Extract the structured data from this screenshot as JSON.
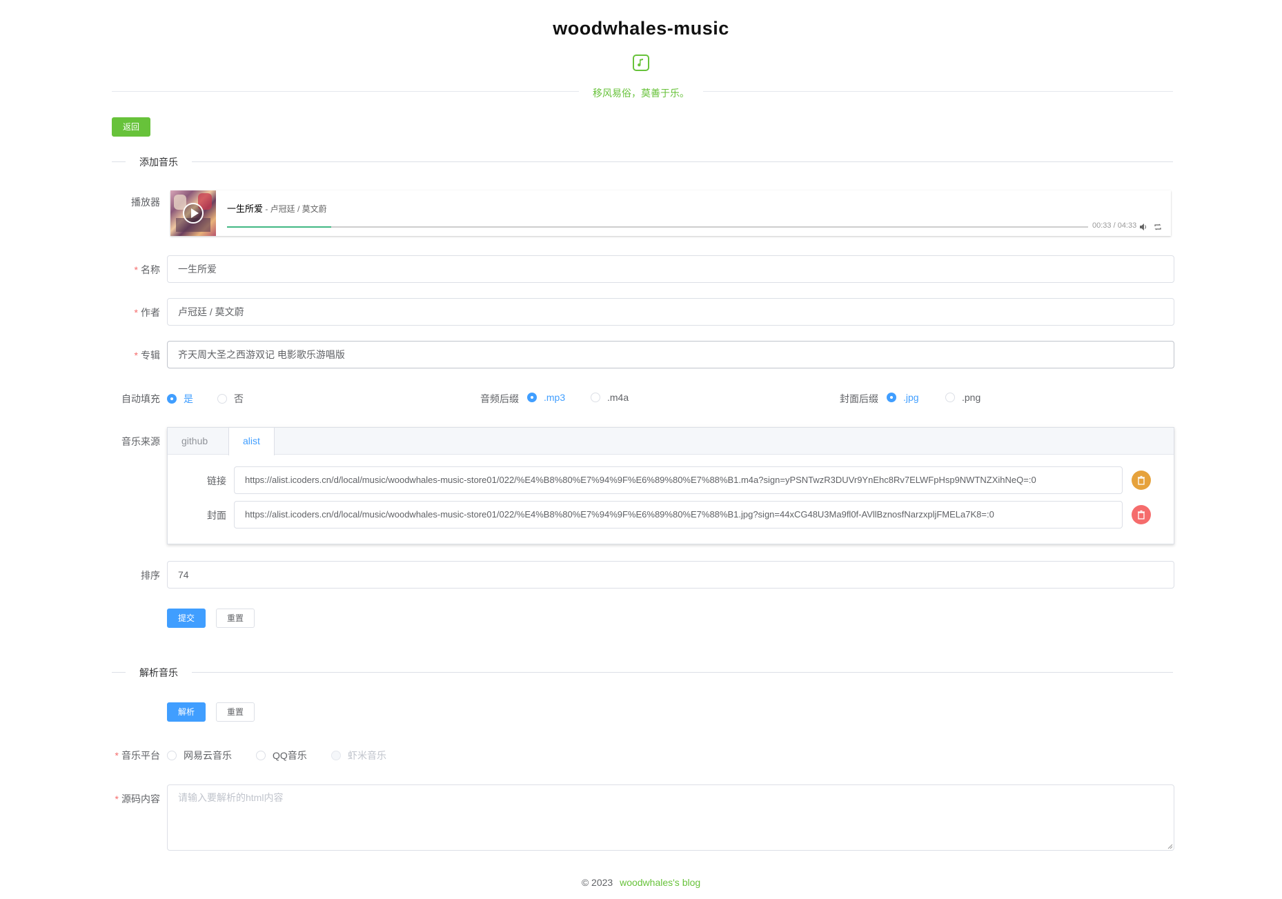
{
  "header": {
    "title": "woodwhales-music",
    "logo_icon": "music-note-icon",
    "slogan": "移风易俗，莫善于乐。"
  },
  "back_button": "返回",
  "add_section": {
    "title": "添加音乐",
    "player_label": "播放器",
    "player": {
      "song_title": "一生所爱",
      "song_author": " - 卢冠廷 / 莫文蔚",
      "time": "00:33 / 04:33",
      "progress": 0.121
    },
    "name_label": "名称",
    "name_value": "一生所爱",
    "author_label": "作者",
    "author_value": "卢冠廷 / 莫文蔚",
    "album_label": "专辑",
    "album_value": "齐天周大圣之西游双记 电影歌乐游唱版",
    "autofill": {
      "label": "自动填充",
      "options": [
        "是",
        "否"
      ],
      "selected": "是"
    },
    "audio_suffix": {
      "label": "音频后缀",
      "options": [
        ".mp3",
        ".m4a"
      ],
      "selected": ".mp3"
    },
    "cover_suffix": {
      "label": "封面后缀",
      "options": [
        ".jpg",
        ".png"
      ],
      "selected": ".jpg"
    },
    "source_label": "音乐来源",
    "source_tabs": [
      "github",
      "alist"
    ],
    "active_tab": "alist",
    "link_label": "链接",
    "link_value": "https://alist.icoders.cn/d/local/music/woodwhales-music-store01/022/%E4%B8%80%E7%94%9F%E6%89%80%E7%88%B1.m4a?sign=yPSNTwzR3DUVr9YnEhc8Rv7ELWFpHsp9NWTNZXihNeQ=:0",
    "cover_label": "封面",
    "cover_value": "https://alist.icoders.cn/d/local/music/woodwhales-music-store01/022/%E4%B8%80%E7%94%9F%E6%89%80%E7%88%B1.jpg?sign=44xCG48U3Ma9fl0f-AVllBznosfNarzxpljFMELa7K8=:0",
    "sort_label": "排序",
    "sort_value": "74",
    "submit_button": "提交",
    "reset_button": "重置"
  },
  "parse_section": {
    "title": "解析音乐",
    "parse_button": "解析",
    "reset_button": "重置",
    "platform": {
      "label": "音乐平台",
      "options": [
        "网易云音乐",
        "QQ音乐",
        "虾米音乐"
      ]
    },
    "source_label": "源码内容",
    "source_placeholder": "请输入要解析的html内容"
  },
  "footer": {
    "copyright": "©  2023",
    "link": "woodwhales's blog"
  },
  "colors": {
    "brand_green": "#67c23a",
    "primary_blue": "#409eff",
    "warning_orange": "#e6a23c",
    "danger_red": "#f56c6c"
  }
}
